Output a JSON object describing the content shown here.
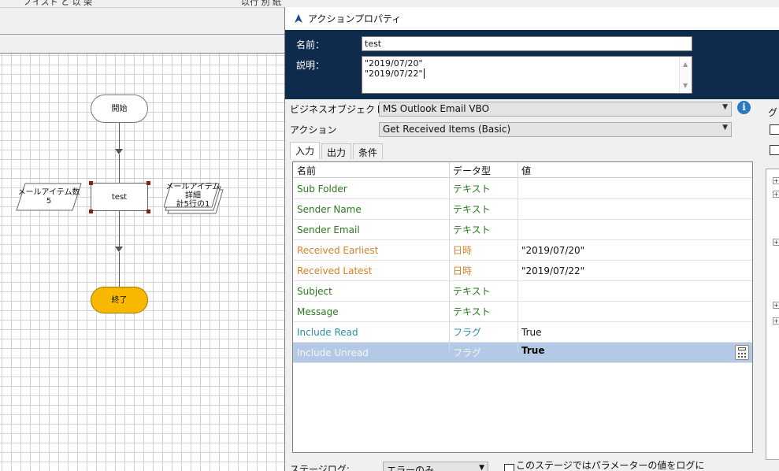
{
  "designer": {
    "top_ghost_text": "ノイスト と 以 架",
    "top_ghost_text2": "以行 別 紙",
    "stages": {
      "start": "開始",
      "end": "終了",
      "action": "test",
      "data_item": {
        "name": "メールアイテム数",
        "value": "5"
      },
      "collection": {
        "name": "メールアイテム詳細",
        "rows": "計5行の1"
      }
    }
  },
  "dialog": {
    "title": "アクションプロパティ",
    "name_label": "名前：",
    "name_value": "test",
    "description_label": "説明：",
    "description_line1": "\"2019/07/20\"",
    "description_line2": "\"2019/07/22\"",
    "business_object_label": "ビジネスオブジェクト",
    "business_object_value": "MS Outlook Email VBO",
    "action_label": "アクション",
    "action_value": "Get Received Items (Basic)",
    "tabs": [
      "入力",
      "出力",
      "条件"
    ],
    "grid": {
      "headers": [
        "名前",
        "データ型",
        "値"
      ],
      "rows": [
        {
          "name": "Sub Folder",
          "type": "テキスト",
          "value": "",
          "color": "#2a7a1e"
        },
        {
          "name": "Sender Name",
          "type": "テキスト",
          "value": "",
          "color": "#2a7a1e"
        },
        {
          "name": "Sender Email",
          "type": "テキスト",
          "value": "",
          "color": "#2a7a1e"
        },
        {
          "name": "Received Earliest",
          "type": "日時",
          "value": "\"2019/07/20\"",
          "color": "#d7802a"
        },
        {
          "name": "Received Latest",
          "type": "日時",
          "value": "\"2019/07/22\"",
          "color": "#d7802a"
        },
        {
          "name": "Subject",
          "type": "テキスト",
          "value": "",
          "color": "#2a7a1e"
        },
        {
          "name": "Message",
          "type": "テキスト",
          "value": "",
          "color": "#2a7a1e"
        },
        {
          "name": "Include Read",
          "type": "フラグ",
          "value": "True",
          "color": "#2b8fa3"
        },
        {
          "name": "Include Unread",
          "type": "フラグ",
          "value": "True",
          "color": "#2b8fa3",
          "selected": true
        }
      ]
    },
    "stage_log_label": "ステージログ:",
    "stage_log_value": "エラーのみ",
    "param_log_label": "このステージではパラメーターの値をログに",
    "right_panel_label": "グ"
  }
}
